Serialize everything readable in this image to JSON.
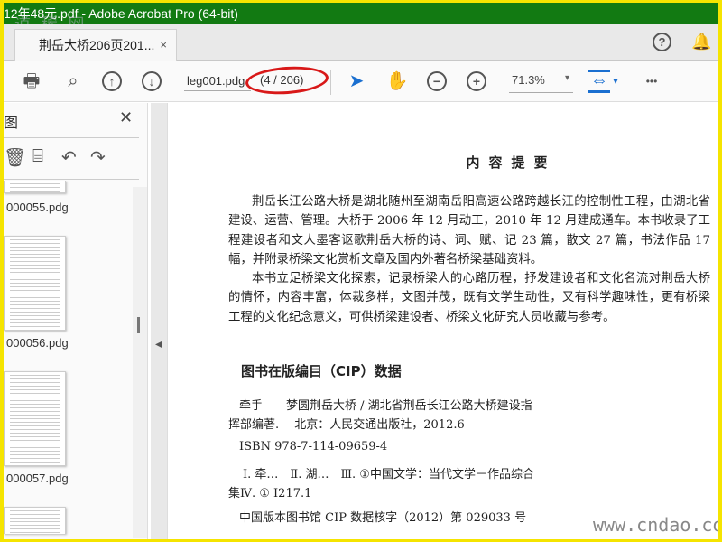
{
  "titlebar": {
    "title": "12年48元.pdf - Adobe Acrobat Pro (64-bit)",
    "watermark": "道 稀 网"
  },
  "tab": {
    "label": "荆岳大桥206页201...",
    "close": "×"
  },
  "header": {
    "help": "?",
    "bell": "🔔"
  },
  "toolbar": {
    "print": "🖶",
    "zoom_search": "⌕",
    "prev": "↑",
    "next": "↓",
    "page_field": "leg001.pdg",
    "page_count": "(4 / 206)",
    "select": "➤",
    "hand": "✋",
    "zoom_out": "−",
    "zoom_in": "+",
    "zoom_value": "71.3%",
    "zoom_dropdown": "▾",
    "fit": "⇔",
    "fit_dropdown": "▾",
    "more": "•••"
  },
  "sidebar": {
    "title": "图",
    "close": "✕",
    "tools": {
      "delete": "🗑",
      "extract": "⌸",
      "undo": "↶",
      "redo": "↷"
    },
    "thumbnails": [
      {
        "label": "000055.pdg"
      },
      {
        "label": "000056.pdg"
      },
      {
        "label": "000057.pdg"
      }
    ]
  },
  "document": {
    "heading": "内容提要",
    "paragraphs": [
      "荆岳长江公路大桥是湖北随州至湖南岳阳高速公路跨越长江的控制性工程，由湖北省建设、运营、管理。大桥于 2006 年 12 月动工，2010 年 12 月建成通车。本书收录了工程建设者和文人墨客讴歌荆岳大桥的诗、词、赋、记 23 篇，散文 27 篇，书法作品 17 幅，并附录桥梁文化赏析文章及国内外著名桥梁基础资料。",
      "本书立足桥梁文化探索，记录桥梁人的心路历程，抒发建设者和文化名流对荆岳大桥的情怀，内容丰富，体裁多样，文图并茂，既有文学生动性，又有科学趣味性，更有桥梁工程的文化纪念意义，可供桥梁建设者、桥梁文化研究人员收藏与参考。"
    ],
    "cip_heading": "图书在版编目（CIP）数据",
    "cip_line1": "牵手——梦圆荆岳大桥 / 湖北省荆岳长江公路大桥建设指挥部编著. —北京：人民交通出版社，2012.6",
    "isbn": "ISBN 978-7-114-09659-4",
    "classification": "Ⅰ. 牵…　Ⅱ. 湖…　Ⅲ. ①中国文学：当代文学－作品综合集Ⅳ. ① I217.1",
    "cip_number": "中国版本图书馆 CIP 数据核字（2012）第 029033 号",
    "watermark": "www.cndao.com"
  }
}
